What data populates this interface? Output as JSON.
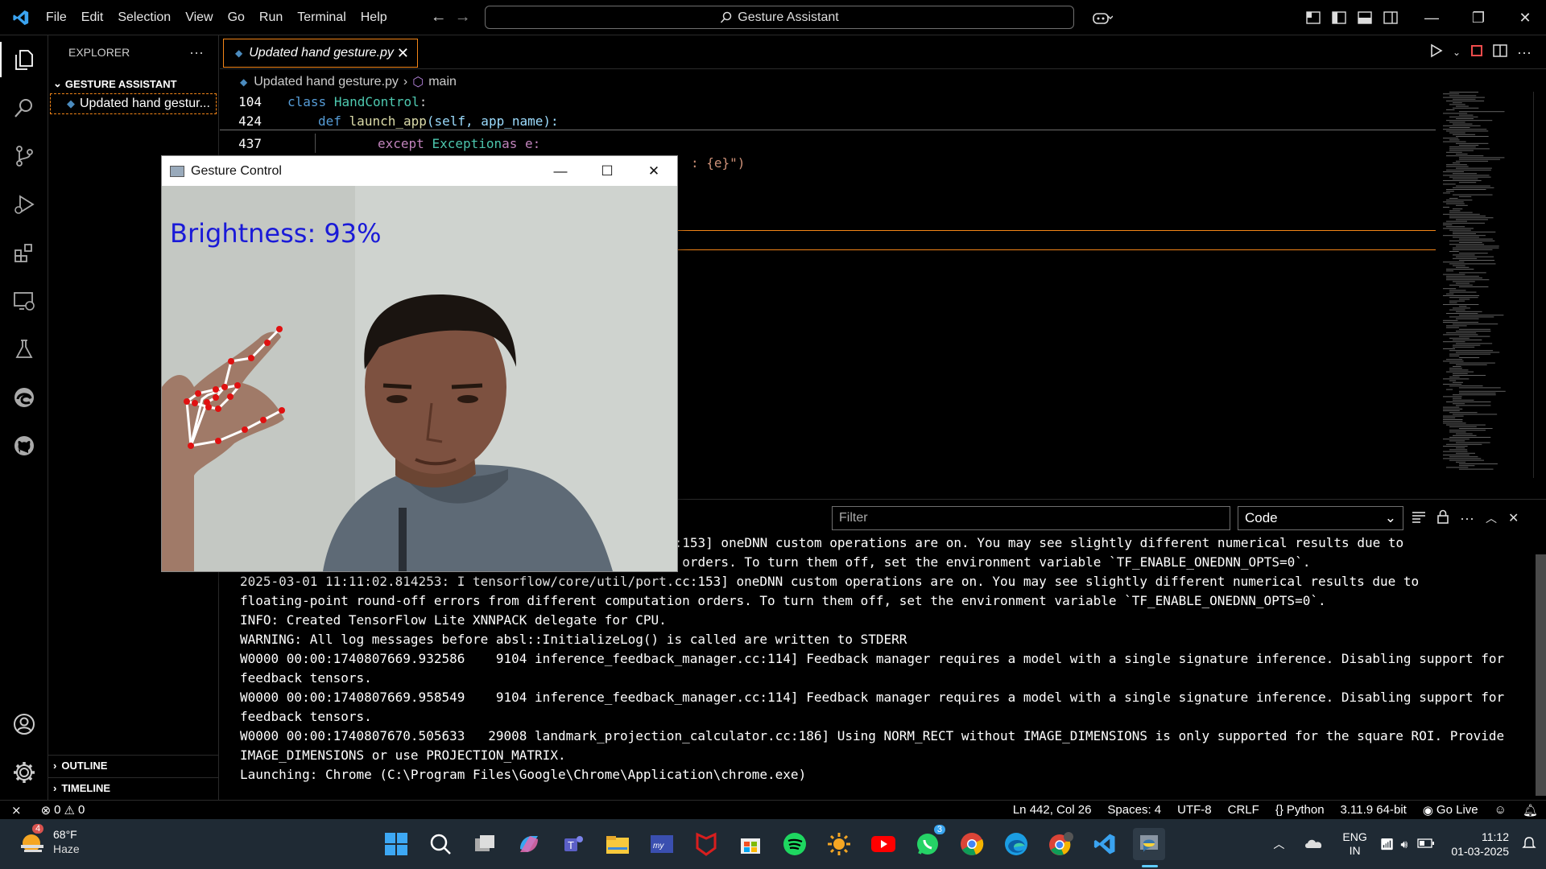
{
  "window": {
    "command_center": "Gesture Assistant"
  },
  "menu": [
    "File",
    "Edit",
    "Selection",
    "View",
    "Go",
    "Run",
    "Terminal",
    "Help"
  ],
  "sidebar": {
    "header": "EXPLORER",
    "section": "GESTURE ASSISTANT",
    "file": "Updated hand gestur...",
    "outline": "OUTLINE",
    "timeline": "TIMELINE"
  },
  "editor": {
    "tab_label": "Updated hand gesture.py",
    "breadcrumb_file": "Updated hand gesture.py",
    "breadcrumb_symbol": "main",
    "lines": [
      {
        "num": "104",
        "kw": "class",
        "name": "HandControl",
        "rest": ":"
      },
      {
        "num": "424",
        "kw": "def",
        "name": "launch_app",
        "rest": "(self, app_name):"
      },
      {
        "num": "437",
        "kw": "except",
        "name": "Exception",
        "rest": " as e:"
      }
    ],
    "partial_line": ": {e}\")"
  },
  "panel": {
    "filter_placeholder": "Filter",
    "select_value": "Code",
    "output": [
      "c:153] oneDNN custom operations are on. You may see slightly different numerical results due to",
      "n orders. To turn them off, set the environment variable `TF_ENABLE_ONEDNN_OPTS=0`.",
      "2025-03-01 11:11:02.814253: I tensorflow/core/util/port.cc:153] oneDNN custom operations are on. You may see slightly different numerical results due to",
      "floating-point round-off errors from different computation orders. To turn them off, set the environment variable `TF_ENABLE_ONEDNN_OPTS=0`.",
      "INFO: Created TensorFlow Lite XNNPACK delegate for CPU.",
      "WARNING: All log messages before absl::InitializeLog() is called are written to STDERR",
      "W0000 00:00:1740807669.932586    9104 inference_feedback_manager.cc:114] Feedback manager requires a model with a single signature inference. Disabling support for",
      "feedback tensors.",
      "W0000 00:00:1740807669.958549    9104 inference_feedback_manager.cc:114] Feedback manager requires a model with a single signature inference. Disabling support for",
      "feedback tensors.",
      "W0000 00:00:1740807670.505633   29008 landmark_projection_calculator.cc:186] Using NORM_RECT without IMAGE_DIMENSIONS is only supported for the square ROI. Provide",
      "IMAGE_DIMENSIONS or use PROJECTION_MATRIX.",
      "Launching: Chrome (C:\\Program Files\\Google\\Chrome\\Application\\chrome.exe)"
    ]
  },
  "gesture_window": {
    "title": "Gesture Control",
    "overlay": "Brightness: 93%"
  },
  "statusbar": {
    "errors": "0",
    "warnings": "0",
    "position": "Ln 442, Col 26",
    "spaces": "Spaces: 4",
    "encoding": "UTF-8",
    "eol": "CRLF",
    "language": "Python",
    "interpreter": "3.11.9 64-bit",
    "golive": "Go Live"
  },
  "taskbar": {
    "temp": "68°F",
    "weather": "Haze",
    "weather_badge": "4",
    "whatsapp_badge": "3",
    "lang1": "ENG",
    "lang2": "IN",
    "time": "11:12",
    "date": "01-03-2025"
  },
  "colors": {
    "accent": "#f38518",
    "brightness_text": "#1a1ad8"
  }
}
